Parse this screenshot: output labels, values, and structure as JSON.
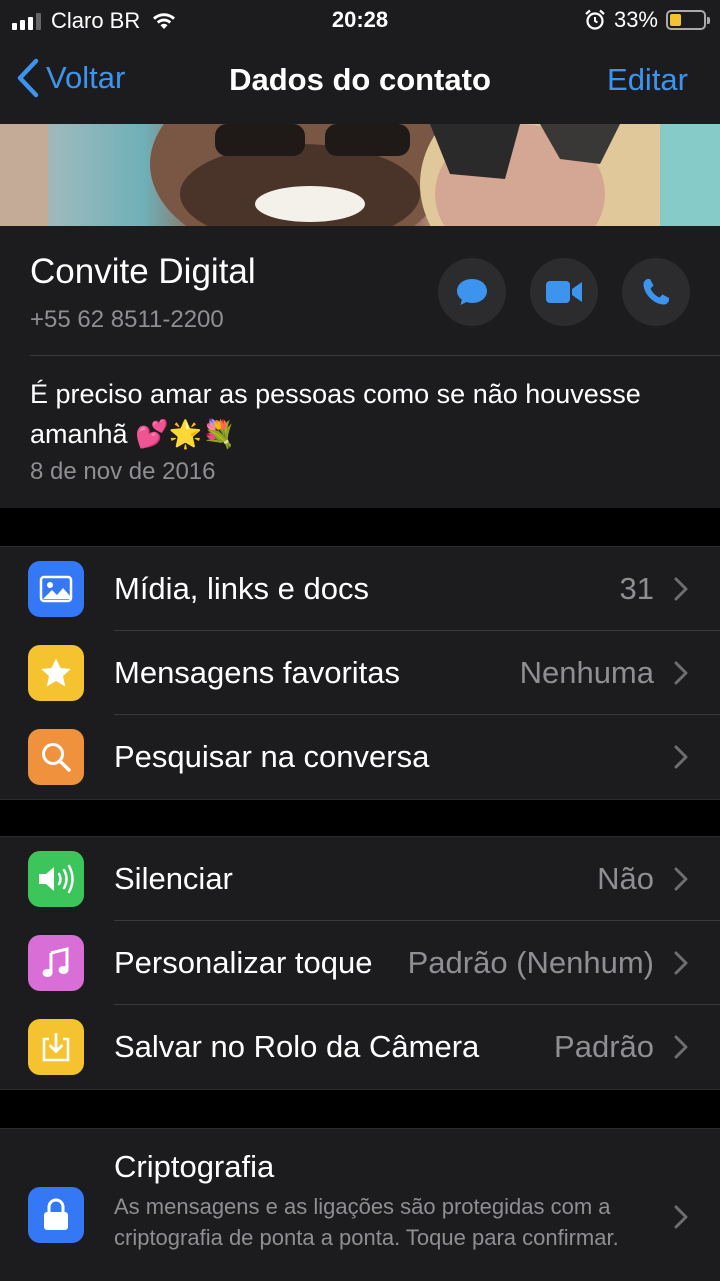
{
  "status_bar": {
    "carrier": "Claro BR",
    "time": "20:28",
    "battery_percent": "33%",
    "battery_level": 0.33,
    "icons": [
      "signal-icon",
      "wifi-icon",
      "alarm-icon",
      "battery-icon"
    ]
  },
  "nav": {
    "back_label": "Voltar",
    "title": "Dados do contato",
    "edit_label": "Editar"
  },
  "contact": {
    "name": "Convite Digital",
    "phone": "+55 62 8511-2200",
    "status": "É preciso amar as pessoas como se não houvesse amanhã 💕🌟💐",
    "status_date": "8 de nov de 2016",
    "actions": [
      "message-icon",
      "video-call-icon",
      "phone-call-icon"
    ]
  },
  "group1": [
    {
      "label": "Mídia, links e docs",
      "value": "31",
      "icon": "photo-icon",
      "color": "#3478f6"
    },
    {
      "label": "Mensagens favoritas",
      "value": "Nenhuma",
      "icon": "star-icon",
      "color": "#f5c330"
    },
    {
      "label": "Pesquisar na conversa",
      "value": "",
      "icon": "search-icon",
      "color": "#f0913d"
    }
  ],
  "group2": [
    {
      "label": "Silenciar",
      "value": "Não",
      "icon": "speaker-icon",
      "color": "#3bc55b"
    },
    {
      "label": "Personalizar toque",
      "value": "Padrão (Nenhum)",
      "icon": "music-note-icon",
      "color": "#d96fd6"
    },
    {
      "label": "Salvar no Rolo da Câmera",
      "value": "Padrão",
      "icon": "download-icon",
      "color": "#f5c330"
    }
  ],
  "crypto": {
    "title": "Criptografia",
    "description": "As mensagens e as ligações são protegidas com a criptografia de ponta a ponta. Toque para confirmar.",
    "icon": "lock-icon",
    "color": "#3478f6"
  },
  "colors": {
    "accent": "#3d94ef",
    "background": "#000000",
    "cell": "#1c1c1e",
    "secondary_text": "#8e8e93"
  }
}
